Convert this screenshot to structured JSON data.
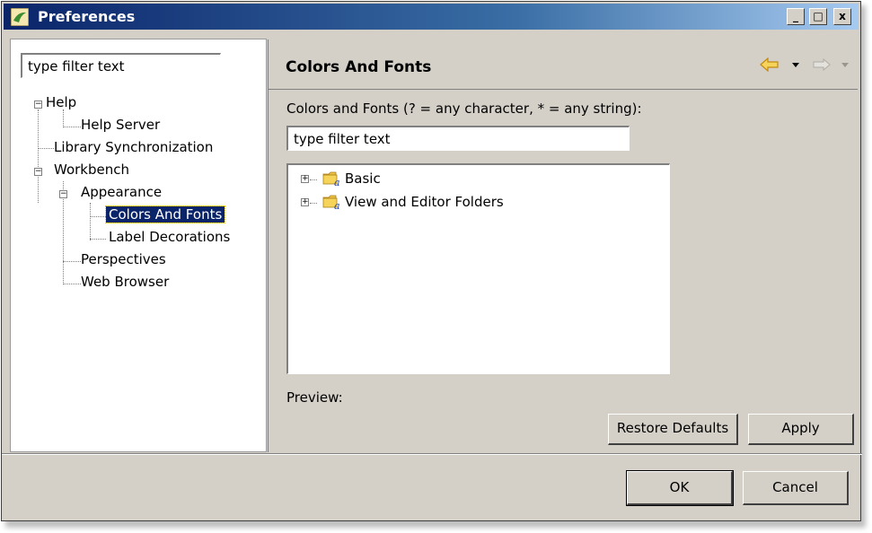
{
  "window": {
    "title": "Preferences",
    "controls": [
      "_",
      "□",
      "x"
    ]
  },
  "sidebar": {
    "filter_value": "type filter text",
    "tree": [
      {
        "label": "Help",
        "level": 0,
        "expander": "−"
      },
      {
        "label": "Help Server",
        "level": 1
      },
      {
        "label": "Library Synchronization",
        "level": 0
      },
      {
        "label": "Workbench",
        "level": 0,
        "expander": "−"
      },
      {
        "label": "Appearance",
        "level": 1,
        "expander": "−"
      },
      {
        "label": "Colors And Fonts",
        "level": 2,
        "selected": true
      },
      {
        "label": "Label Decorations",
        "level": 2
      },
      {
        "label": "Perspectives",
        "level": 1
      },
      {
        "label": "Web Browser",
        "level": 1
      }
    ]
  },
  "page": {
    "title": "Colors And Fonts",
    "filter_label": "Colors and Fonts (? = any character, * = any string):",
    "filter_value": "type filter text",
    "categories": [
      {
        "label": "Basic",
        "expander": "+"
      },
      {
        "label": "View and Editor Folders",
        "expander": "+"
      }
    ],
    "preview_label": "Preview:",
    "restore_defaults": "Restore Defaults",
    "apply": "Apply"
  },
  "footer": {
    "ok": "OK",
    "cancel": "Cancel"
  },
  "colors": {
    "title_start": "#0a246a",
    "title_end": "#a6caf0",
    "selection": "#0a246a",
    "nav_arrow": "#e8a817"
  },
  "icons": [
    "preferences-app-icon",
    "back-arrow-icon",
    "forward-arrow-icon",
    "folder-icon"
  ]
}
